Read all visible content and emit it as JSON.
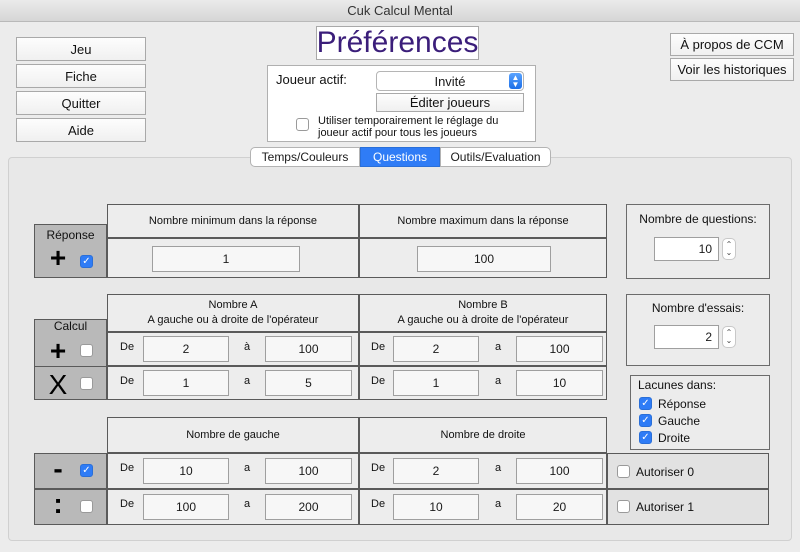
{
  "window": {
    "title": "Cuk Calcul Mental"
  },
  "menu": {
    "jeu": "Jeu",
    "fiche": "Fiche",
    "quitter": "Quitter",
    "aide": "Aide"
  },
  "header": {
    "title": "Préférences",
    "about": "À propos de CCM",
    "history": "Voir les historiques"
  },
  "player": {
    "label": "Joueur actif:",
    "selected": "Invité",
    "edit": "Éditer joueurs",
    "temp_option": "Utiliser temporairement le réglage du joueur actif pour tous les joueurs",
    "temp_checked": false
  },
  "tabs": {
    "t1": "Temps/Couleurs",
    "t2": "Questions",
    "t3": "Outils/Evaluation",
    "active": "Questions"
  },
  "reponse": {
    "section": "Réponse",
    "op": "+",
    "checked": true,
    "min_header": "Nombre minimum dans la réponse",
    "max_header": "Nombre maximum dans la réponse",
    "min": "1",
    "max": "100"
  },
  "calcul": {
    "section": "Calcul",
    "a_header_1": "Nombre A",
    "a_header_2": "A gauche ou à droite de l'opérateur",
    "b_header_1": "Nombre B",
    "b_header_2": "A gauche ou à droite de l'opérateur",
    "de": "De",
    "a": "à",
    "a_plain": "a",
    "plus": {
      "op": "+",
      "checked": false,
      "a_from": "2",
      "a_to": "100",
      "b_from": "2",
      "b_to": "100"
    },
    "times": {
      "op": "X",
      "checked": false,
      "a_from": "1",
      "a_to": "5",
      "b_from": "1",
      "b_to": "10"
    }
  },
  "lower": {
    "left_header": "Nombre de gauche",
    "right_header": "Nombre de droite",
    "minus": {
      "op": "-",
      "checked": true,
      "l_from": "10",
      "l_to": "100",
      "r_from": "2",
      "r_to": "100",
      "extra": "Autoriser 0"
    },
    "div": {
      "op": ":",
      "checked": false,
      "l_from": "100",
      "l_to": "200",
      "r_from": "10",
      "r_to": "20",
      "extra": "Autoriser 1"
    }
  },
  "side": {
    "questions_label": "Nombre de questions:",
    "questions_value": "10",
    "essais_label": "Nombre d'essais:",
    "essais_value": "2",
    "lacunes_label": "Lacunes dans:",
    "lacunes": [
      {
        "label": "Réponse",
        "checked": true
      },
      {
        "label": "Gauche",
        "checked": true
      },
      {
        "label": "Droite",
        "checked": true
      }
    ]
  },
  "icons": {
    "check": "checkmark-icon",
    "updown": "stepper-icon",
    "select": "popup-arrows-icon"
  },
  "colors": {
    "accent": "#2f7cf6",
    "title": "#3b1e7a"
  }
}
